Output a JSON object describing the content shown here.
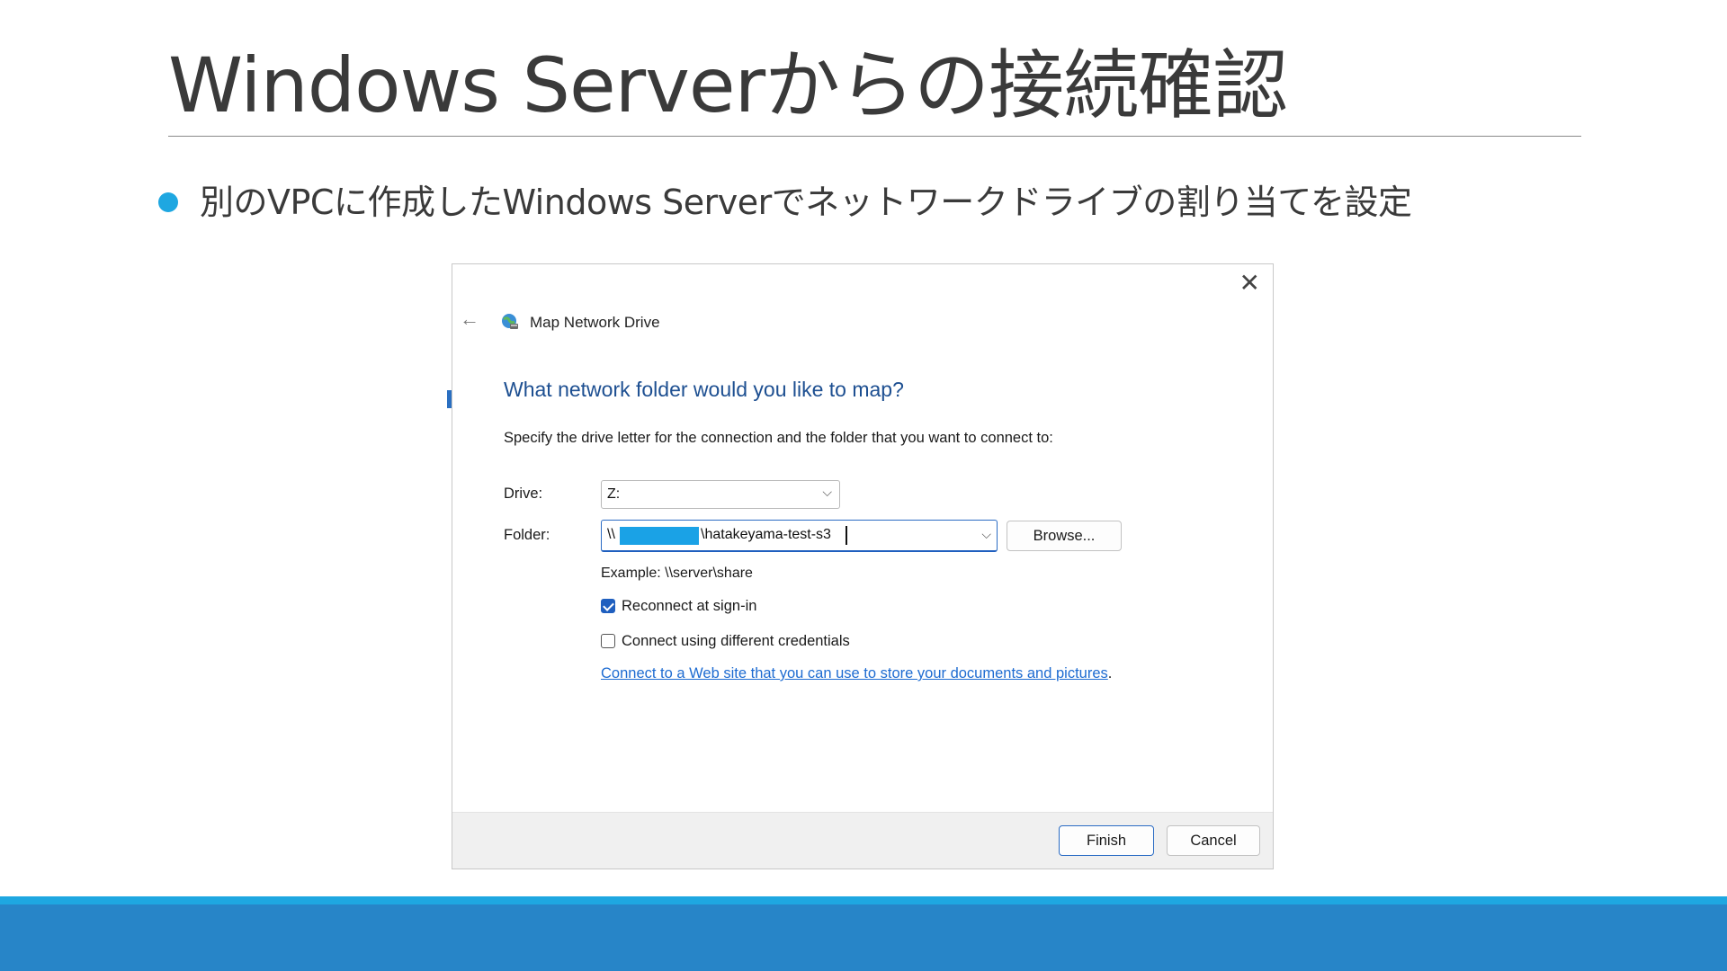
{
  "slide": {
    "title": "Windows Serverからの接続確認",
    "bullet": "別のVPCに作成したWindows Serverでネットワークドライブの割り当てを設定"
  },
  "dialog": {
    "caption": "Map Network Drive",
    "heading": "What network folder would you like to map?",
    "instruction": "Specify the drive letter for the connection and the folder that you want to connect to:",
    "drive_label": "Drive:",
    "drive_value": "Z:",
    "folder_label": "Folder:",
    "folder_prefix": "\\\\",
    "folder_suffix": "\\hatakeyama-test-s3",
    "browse_label": "Browse...",
    "example": "Example: \\\\server\\share",
    "reconnect_label": "Reconnect at sign-in",
    "reconnect_checked": true,
    "credentials_label": "Connect using different credentials",
    "credentials_checked": false,
    "link_text": "Connect to a Web site that you can use to store your documents and pictures",
    "link_period": ".",
    "finish_label": "Finish",
    "cancel_label": "Cancel",
    "close_glyph": "✕",
    "back_glyph": "←"
  },
  "colors": {
    "accent": "#1ea7e1",
    "band": "#2785c8",
    "heading": "#1d4f91",
    "link": "#1d6bd1",
    "redaction": "#1aa2e6"
  }
}
